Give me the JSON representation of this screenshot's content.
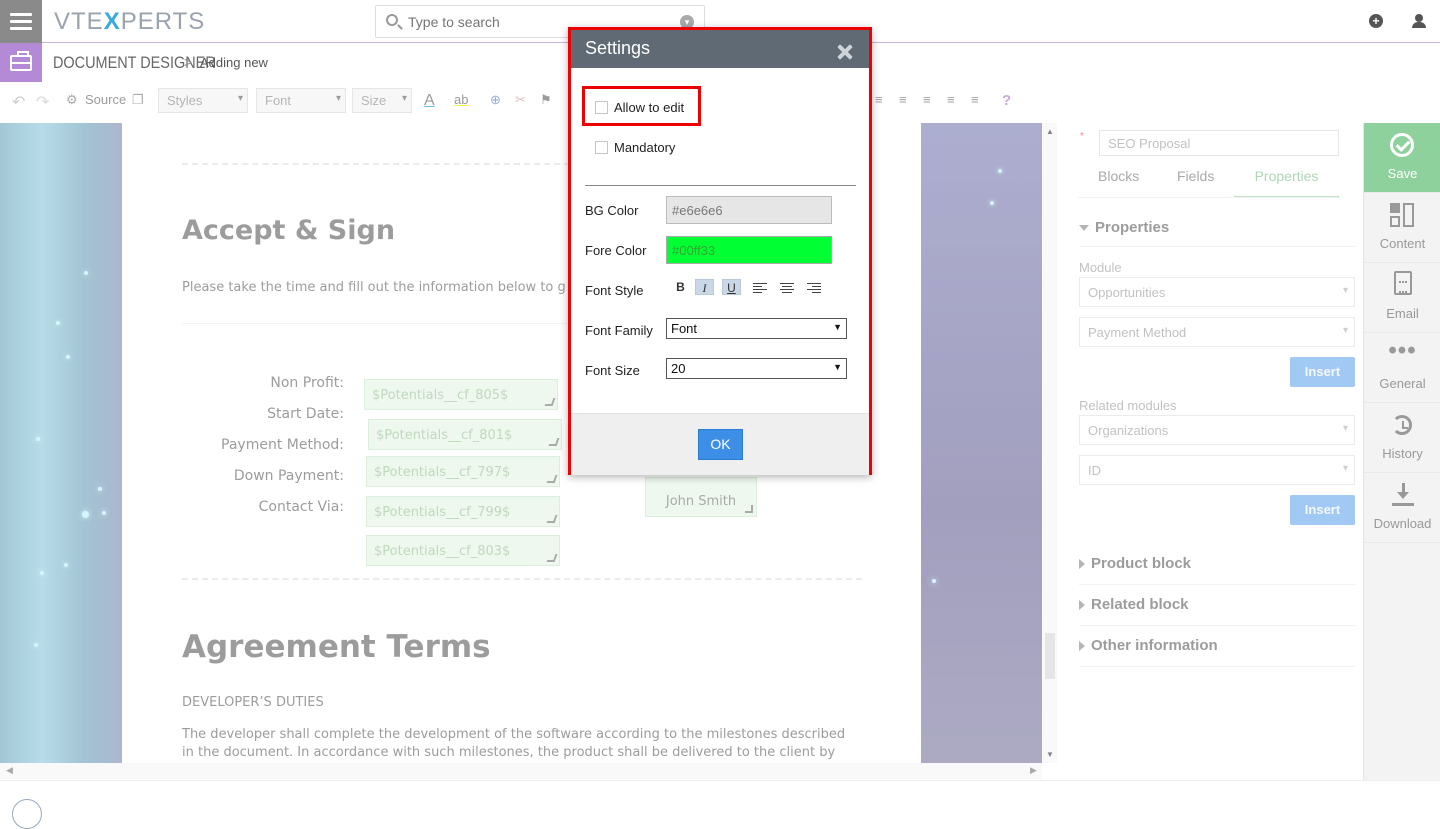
{
  "header": {
    "logo_left": "VTE",
    "logo_x": "X",
    "logo_right": "PERTS",
    "search_placeholder": "Type to search"
  },
  "breadcrumb": {
    "module": "DOCUMENT DESIGNER",
    "separator": ">",
    "page": "Adding new"
  },
  "toolbar": {
    "source_label": "Source",
    "styles_label": "Styles",
    "font_label": "Font",
    "size_label": "Size",
    "help_label": "?"
  },
  "document": {
    "section1_title": "Accept & Sign",
    "section1_text": "Please take the time and fill out the information below to g",
    "fields": [
      {
        "label": "Non Profit:",
        "value": "$Potentials__cf_805$"
      },
      {
        "label": "Start Date:",
        "value": "$Potentials__cf_801$"
      },
      {
        "label": "Payment Method:",
        "value": "$Potentials__cf_797$"
      },
      {
        "label": "Down Payment:",
        "value": "$Potentials__cf_799$"
      },
      {
        "label": "Contact Via:",
        "value": "$Potentials__cf_803$"
      }
    ],
    "signature": "John Smith",
    "section2_title": "Agreement Terms",
    "section2_sub": "DEVELOPER’S DUTIES",
    "section2_line1": "The developer shall complete the development of the software according to the milestones described",
    "section2_line2": "in the document. In accordance with such milestones, the product shall be delivered to the client by"
  },
  "right_panel": {
    "template_name": "SEO Proposal",
    "tabs": [
      "Blocks",
      "Fields",
      "Properties"
    ],
    "properties_heading": "Properties",
    "module_label": "Module",
    "module_value": "Opportunities",
    "field_value": "Payment Method",
    "insert_label": "Insert",
    "related_label": "Related modules",
    "related_value": "Organizations",
    "related_field": "ID",
    "product_block": "Product block",
    "related_block": "Related block",
    "other_info": "Other information"
  },
  "vnav": {
    "save": "Save",
    "content": "Content",
    "email": "Email",
    "general": "General",
    "history": "History",
    "download": "Download"
  },
  "modal": {
    "title": "Settings",
    "allow_edit": "Allow to edit",
    "mandatory": "Mandatory",
    "bg_color_label": "BG Color",
    "bg_color_value": "#e6e6e6",
    "fore_color_label": "Fore Color",
    "fore_color_value": "#00ff33",
    "font_style_label": "Font Style",
    "bold": "B",
    "italic": "I",
    "underline": "U",
    "font_family_label": "Font Family",
    "font_family_value": "Font",
    "font_size_label": "Font Size",
    "font_size_value": "20",
    "ok": "OK"
  },
  "colors": {
    "accent": "#3d8ee6",
    "save_green": "#8fd19d",
    "modal_header": "#5f6a74",
    "highlight_red": "#ee0000"
  }
}
